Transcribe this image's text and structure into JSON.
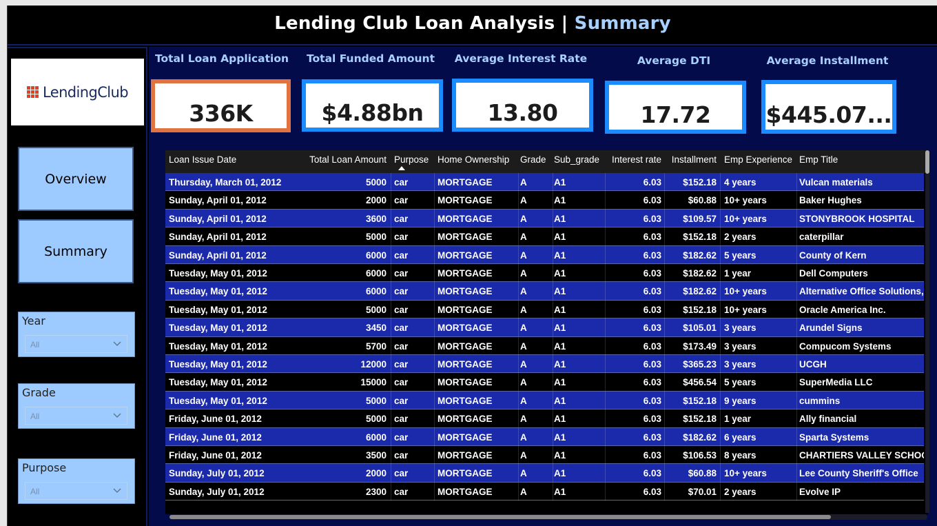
{
  "header": {
    "title": "Lending Club Loan Analysis | ",
    "title_accent": "Summary"
  },
  "sidebar": {
    "logo_text": "LendingClub",
    "nav": {
      "overview": "Overview",
      "summary": "Summary"
    },
    "slicers": {
      "year": {
        "label": "Year",
        "value": "All"
      },
      "grade": {
        "label": "Grade",
        "value": "All"
      },
      "purpose": {
        "label": "Purpose",
        "value": "All"
      }
    }
  },
  "kpis": [
    {
      "label": "Total Loan Application",
      "value": "336K"
    },
    {
      "label": "Total Funded Amount",
      "value": "$4.88bn"
    },
    {
      "label": "Average Interest Rate",
      "value": "13.80"
    },
    {
      "label": "Average DTI",
      "value": "17.72"
    },
    {
      "label": "Average Installment",
      "value": "$445.07..."
    }
  ],
  "colors": {
    "accent": "#a8d0ff",
    "card_border": "#1a8cff",
    "card_border_selected": "#e0733f",
    "row_blue": "#1a2aaa",
    "row_black": "#000000",
    "slicer_bg": "#9ecbff",
    "panel_bg": "#030b4a"
  },
  "table": {
    "sorted_by": "Purpose",
    "columns": [
      "Loan Issue Date",
      "Total Loan Amount",
      "Purpose",
      "Home Ownership",
      "Grade",
      "Sub_grade",
      "Interest rate",
      "Installment",
      "Emp Experience",
      "Emp Title"
    ],
    "rows": [
      [
        "Thursday, March 01, 2012",
        "5000",
        "car",
        "MORTGAGE",
        "A",
        "A1",
        "6.03",
        "$152.18",
        "4 years",
        "Vulcan materials"
      ],
      [
        "Sunday, April 01, 2012",
        "2000",
        "car",
        "MORTGAGE",
        "A",
        "A1",
        "6.03",
        "$60.88",
        "10+ years",
        "Baker Hughes"
      ],
      [
        "Sunday, April 01, 2012",
        "3600",
        "car",
        "MORTGAGE",
        "A",
        "A1",
        "6.03",
        "$109.57",
        "10+ years",
        "STONYBROOK HOSPITAL"
      ],
      [
        "Sunday, April 01, 2012",
        "5000",
        "car",
        "MORTGAGE",
        "A",
        "A1",
        "6.03",
        "$152.18",
        "2 years",
        "caterpillar"
      ],
      [
        "Sunday, April 01, 2012",
        "6000",
        "car",
        "MORTGAGE",
        "A",
        "A1",
        "6.03",
        "$182.62",
        "5 years",
        "County of Kern"
      ],
      [
        "Tuesday, May 01, 2012",
        "6000",
        "car",
        "MORTGAGE",
        "A",
        "A1",
        "6.03",
        "$182.62",
        "1 year",
        "Dell Computers"
      ],
      [
        "Tuesday, May 01, 2012",
        "6000",
        "car",
        "MORTGAGE",
        "A",
        "A1",
        "6.03",
        "$182.62",
        "10+ years",
        "Alternative Office Solutions,"
      ],
      [
        "Tuesday, May 01, 2012",
        "5000",
        "car",
        "MORTGAGE",
        "A",
        "A1",
        "6.03",
        "$152.18",
        "10+ years",
        "Oracle America Inc."
      ],
      [
        "Tuesday, May 01, 2012",
        "3450",
        "car",
        "MORTGAGE",
        "A",
        "A1",
        "6.03",
        "$105.01",
        "3 years",
        "Arundel Signs"
      ],
      [
        "Tuesday, May 01, 2012",
        "5700",
        "car",
        "MORTGAGE",
        "A",
        "A1",
        "6.03",
        "$173.49",
        "3 years",
        "Compucom Systems"
      ],
      [
        "Tuesday, May 01, 2012",
        "12000",
        "car",
        "MORTGAGE",
        "A",
        "A1",
        "6.03",
        "$365.23",
        "3 years",
        "UCGH"
      ],
      [
        "Tuesday, May 01, 2012",
        "15000",
        "car",
        "MORTGAGE",
        "A",
        "A1",
        "6.03",
        "$456.54",
        "5 years",
        "SuperMedia LLC"
      ],
      [
        "Tuesday, May 01, 2012",
        "5000",
        "car",
        "MORTGAGE",
        "A",
        "A1",
        "6.03",
        "$152.18",
        "9 years",
        "cummins"
      ],
      [
        "Friday, June 01, 2012",
        "5000",
        "car",
        "MORTGAGE",
        "A",
        "A1",
        "6.03",
        "$152.18",
        "1 year",
        "Ally financial"
      ],
      [
        "Friday, June 01, 2012",
        "6000",
        "car",
        "MORTGAGE",
        "A",
        "A1",
        "6.03",
        "$182.62",
        "6 years",
        "Sparta Systems"
      ],
      [
        "Friday, June 01, 2012",
        "3500",
        "car",
        "MORTGAGE",
        "A",
        "A1",
        "6.03",
        "$106.53",
        "8 years",
        "CHARTIERS VALLEY SCHOOL"
      ],
      [
        "Sunday, July 01, 2012",
        "2000",
        "car",
        "MORTGAGE",
        "A",
        "A1",
        "6.03",
        "$60.88",
        "10+ years",
        "Lee County Sheriff's Office"
      ],
      [
        "Sunday, July 01, 2012",
        "2300",
        "car",
        "MORTGAGE",
        "A",
        "A1",
        "6.03",
        "$70.01",
        "2 years",
        "Evolve IP"
      ]
    ]
  }
}
